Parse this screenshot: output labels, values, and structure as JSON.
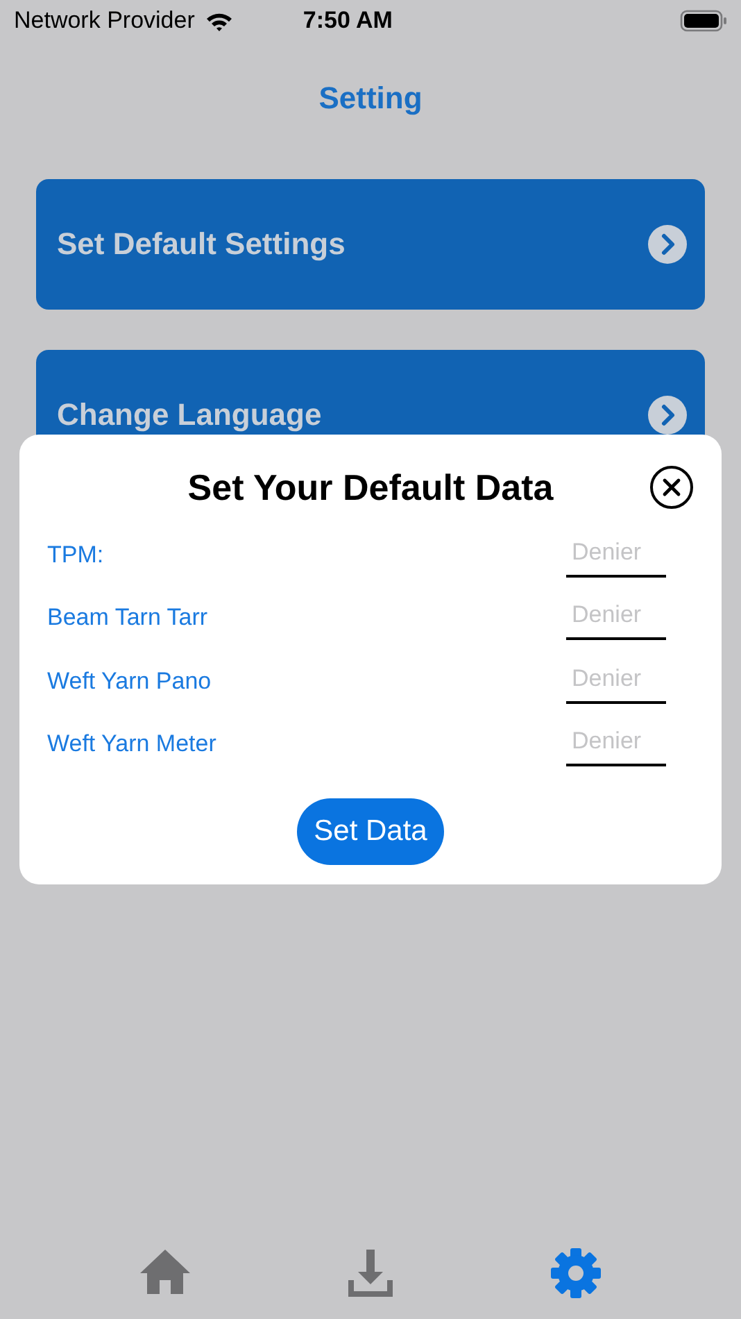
{
  "status_bar": {
    "carrier": "Network Provider",
    "time": "7:50 AM"
  },
  "header": {
    "title": "Setting"
  },
  "menu": [
    {
      "label": "Set Default Settings"
    },
    {
      "label": "Change Language"
    }
  ],
  "dialog": {
    "title": "Set Your Default Data",
    "fields": [
      {
        "label": "TPM:",
        "placeholder": "Denier"
      },
      {
        "label": "Beam Tarn Tarr",
        "placeholder": "Denier"
      },
      {
        "label": "Weft Yarn Pano",
        "placeholder": "Denier"
      },
      {
        "label": "Weft Yarn Meter",
        "placeholder": "Denier"
      }
    ],
    "button": "Set Data"
  },
  "tab_bar": [
    {
      "kind": "home",
      "selected": false
    },
    {
      "kind": "download",
      "selected": false
    },
    {
      "kind": "settings",
      "selected": true
    }
  ]
}
